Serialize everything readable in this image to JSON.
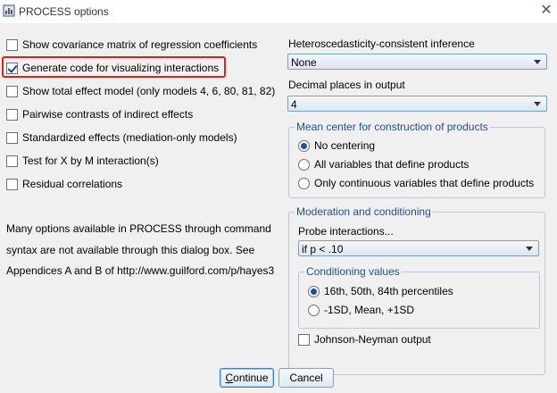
{
  "window": {
    "title": "PROCESS options",
    "close_glyph": "✕",
    "app_icon": "process-app-icon"
  },
  "left_options": [
    {
      "label": "Show covariance matrix of regression coefficients",
      "checked": false
    },
    {
      "label": "Generate code for visualizing interactions",
      "checked": true
    },
    {
      "label": "Show total effect model (only models 4, 6, 80, 81, 82)",
      "checked": false
    },
    {
      "label": "Pairwise contrasts of indirect effects",
      "checked": false
    },
    {
      "label": "Standardized effects (mediation-only models)",
      "checked": false
    },
    {
      "label": "Test for X by M interaction(s)",
      "checked": false
    },
    {
      "label": "Residual correlations",
      "checked": false
    }
  ],
  "note_lines": [
    "Many options available in PROCESS through command",
    "syntax are not available through this dialog box.  See",
    "Appendices A and B of http://www.guilford.com/p/hayes3"
  ],
  "hc_inference": {
    "label": "Heteroscedasticity-consistent inference",
    "value": "None"
  },
  "decimal_places": {
    "label": "Decimal places in output",
    "value": "4"
  },
  "mean_center": {
    "legend": "Mean center for construction of products",
    "options": [
      {
        "label": "No centering",
        "selected": true
      },
      {
        "label": "All variables that define products",
        "selected": false
      },
      {
        "label": "Only continuous variables that define products",
        "selected": false
      }
    ]
  },
  "moderation": {
    "legend": "Moderation and conditioning",
    "probe_label": "Probe interactions...",
    "probe_value": "if p < .10",
    "conditioning": {
      "legend": "Conditioning values",
      "options": [
        {
          "label": "16th, 50th, 84th percentiles",
          "selected": true
        },
        {
          "label": "-1SD, Mean, +1SD",
          "selected": false
        }
      ]
    },
    "johnson_neyman": {
      "label": "Johnson-Neyman output",
      "checked": false
    }
  },
  "buttons": {
    "continue_accel": "C",
    "continue_rest": "ontinue",
    "cancel": "Cancel"
  },
  "colors": {
    "highlight": "#e02020",
    "group_legend": "#1f4f8f",
    "dialog_bg": "#f0f0f0"
  }
}
